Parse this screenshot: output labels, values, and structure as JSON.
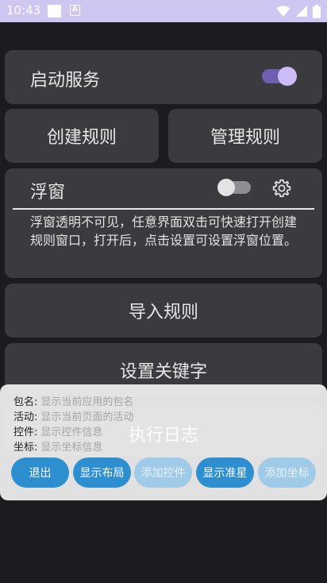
{
  "status_bar": {
    "time": "10:43",
    "a_badge": "A"
  },
  "service_card": {
    "label": "启动服务"
  },
  "create_rule": {
    "label": "创建规则"
  },
  "manage_rule": {
    "label": "管理规则"
  },
  "float_window": {
    "label": "浮窗",
    "description": "浮窗透明不可见，任意界面双击可快速打开创建规则窗口，打开后，点击设置可设置浮窗位置。"
  },
  "import_rule": {
    "label": "导入规则"
  },
  "set_keyword": {
    "label": "设置关键字"
  },
  "exec_log": {
    "label": "执行日志"
  },
  "overlay": {
    "rows": [
      {
        "key": "包名:",
        "value": "显示当前应用的包名"
      },
      {
        "key": "活动:",
        "value": "显示当前页面的活动"
      },
      {
        "key": "控件:",
        "value": "显示控件信息"
      },
      {
        "key": "坐标:",
        "value": "显示坐标信息"
      }
    ],
    "buttons": [
      {
        "label": "退出"
      },
      {
        "label": "显示布局"
      },
      {
        "label": "添加控件"
      },
      {
        "label": "显示准星"
      },
      {
        "label": "添加坐标"
      }
    ]
  },
  "colors": {
    "accent": "#2e8fd0",
    "toggle_on": "#cdbdf7",
    "status_bar": "#cfc6f2"
  }
}
